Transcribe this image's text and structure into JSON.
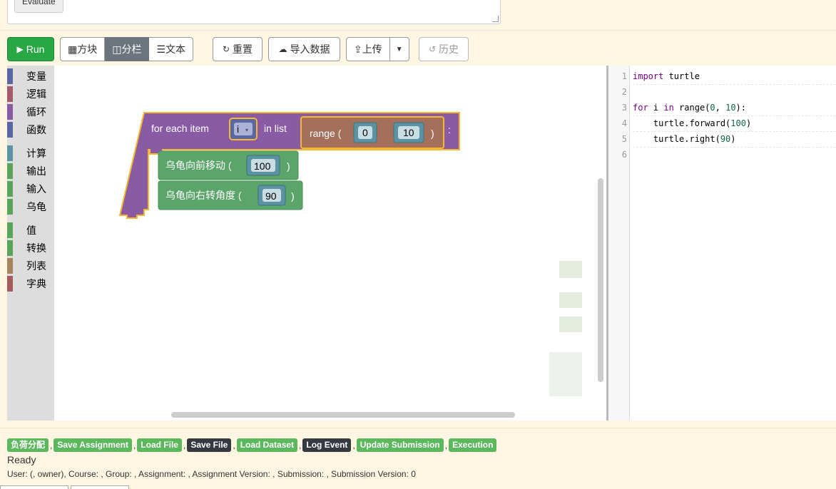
{
  "top": {
    "evaluate_label": "Evaluate"
  },
  "toolbar": {
    "run": "Run",
    "view_blocks": "方块",
    "view_split": "分栏",
    "view_text": "文本",
    "reset": "重置",
    "import_data": "导入数据",
    "upload": "上传",
    "history": "历史"
  },
  "toolbox": {
    "categories": [
      {
        "label": "变量",
        "color": "#5b67a5"
      },
      {
        "label": "逻辑",
        "color": "#a55b6b"
      },
      {
        "label": "循环",
        "color": "#8a5ba5"
      },
      {
        "label": "函数",
        "color": "#5b67a5"
      },
      {
        "label": "计算",
        "color": "#5b93a5"
      },
      {
        "label": "输出",
        "color": "#5ba55b"
      },
      {
        "label": "输入",
        "color": "#5ba55b"
      },
      {
        "label": "乌龟",
        "color": "#5ba55b"
      },
      {
        "label": "值",
        "color": "#5ba55b"
      },
      {
        "label": "转换",
        "color": "#5ba55b"
      },
      {
        "label": "列表",
        "color": "#a5845b"
      },
      {
        "label": "字典",
        "color": "#a55b5b"
      }
    ]
  },
  "blocks": {
    "loop_prefix": "for each item",
    "loop_var": "i",
    "loop_in": "in list",
    "loop_colon": ":",
    "range_label": "range (",
    "range_close": ")",
    "range_start": "0",
    "range_end": "10",
    "forward_label": "乌龟向前移动 (",
    "forward_value": "100",
    "forward_close": ")",
    "right_label": "乌龟向右转角度 (",
    "right_value": "90",
    "right_close": ")"
  },
  "code": {
    "lines": [
      {
        "n": "1",
        "text": "import turtle"
      },
      {
        "n": "2",
        "text": ""
      },
      {
        "n": "3",
        "text": "for i in range(0, 10):"
      },
      {
        "n": "4",
        "text": "    turtle.forward(100)"
      },
      {
        "n": "5",
        "text": "    turtle.right(90)"
      },
      {
        "n": "6",
        "text": ""
      }
    ]
  },
  "status": {
    "pills": [
      {
        "label": "负荷分配",
        "dark": false
      },
      {
        "label": "Save Assignment",
        "dark": false
      },
      {
        "label": "Load File",
        "dark": false
      },
      {
        "label": "Save File",
        "dark": true
      },
      {
        "label": "Load Dataset",
        "dark": false
      },
      {
        "label": "Log Event",
        "dark": true
      },
      {
        "label": "Update Submission",
        "dark": false
      },
      {
        "label": "Execution",
        "dark": false
      }
    ],
    "ready": "Ready",
    "userline": "User: (, owner), Course: , Group: , Assignment: , Assignment Version: , Submission: , Submission Version: 0"
  }
}
